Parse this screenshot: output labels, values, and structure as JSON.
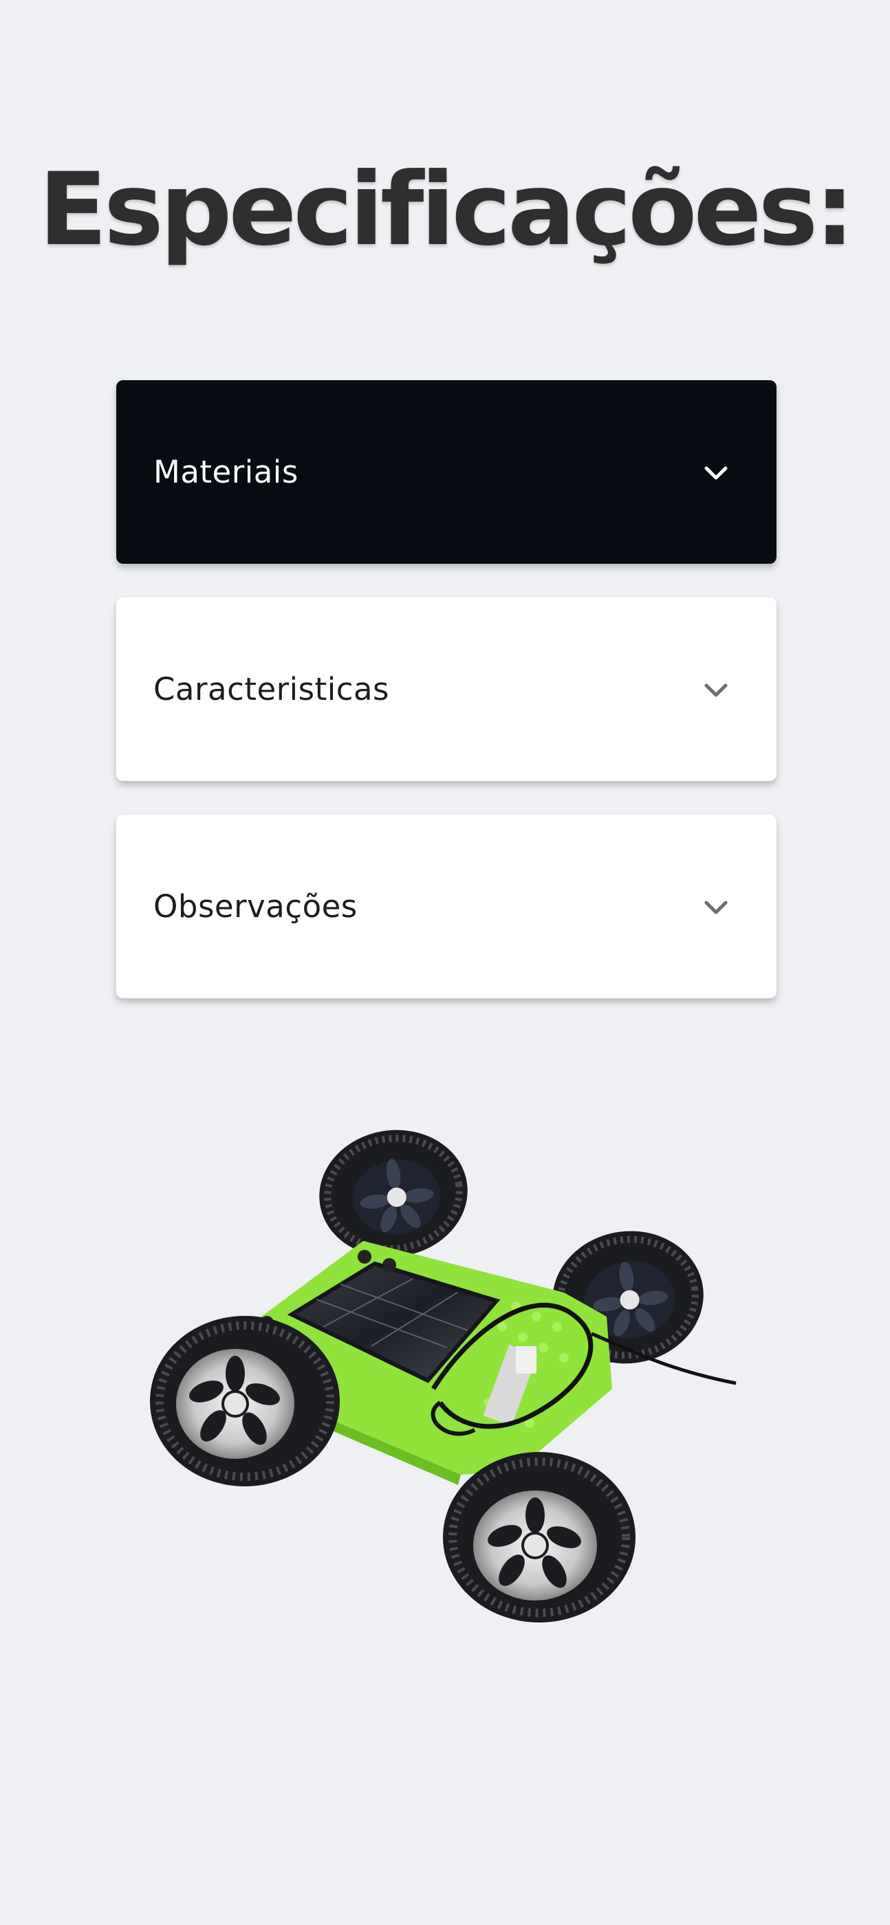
{
  "title": "Especificações:",
  "accordion": {
    "items": [
      {
        "label": "Materiais",
        "expanded": true
      },
      {
        "label": "Caracteristicas",
        "expanded": false
      },
      {
        "label": "Observações",
        "expanded": false
      }
    ]
  },
  "icons": {
    "chevron": "chevron-down-icon"
  },
  "colors": {
    "background": "#eef0f3",
    "active_panel": "#070b12",
    "panel": "#ffffff",
    "title": "#2f2f2f",
    "car_body": "#8fe33a"
  }
}
